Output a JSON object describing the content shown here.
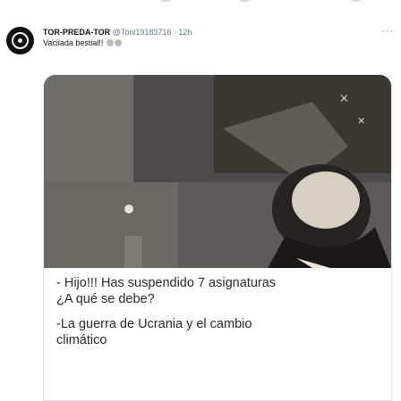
{
  "tweet": {
    "author_name": "TOR-PREDA-TOR",
    "handle": "@Toni19183716",
    "separator": "·",
    "time": "12h",
    "text": "Vacilada bestial!!",
    "more_label": "···"
  },
  "media": {
    "caption_lines": [
      "- Hijo!!! Has suspendido 7 asignaturas",
      "¿A qué se debe?",
      "-La guerra de Ucrania y el cambio",
      "climático"
    ]
  },
  "icons": [
    "avatar-logo-icon",
    "more-options-icon",
    "laughing-emoji-icon"
  ],
  "colors": {
    "secondary_text": "#657786",
    "border": "#e1e8ed",
    "text": "#14171a"
  }
}
